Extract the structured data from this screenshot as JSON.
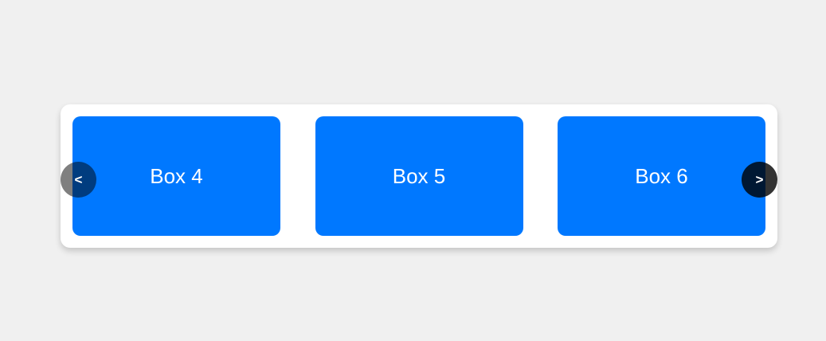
{
  "carousel": {
    "prev_label": "<",
    "next_label": ">",
    "boxes": [
      {
        "label": "Box 4"
      },
      {
        "label": "Box 5"
      },
      {
        "label": "Box 6"
      }
    ]
  },
  "colors": {
    "page_background": "#f0f0f0",
    "card_background": "#ffffff",
    "box_color": "#0078ff",
    "box_text": "#ffffff"
  }
}
